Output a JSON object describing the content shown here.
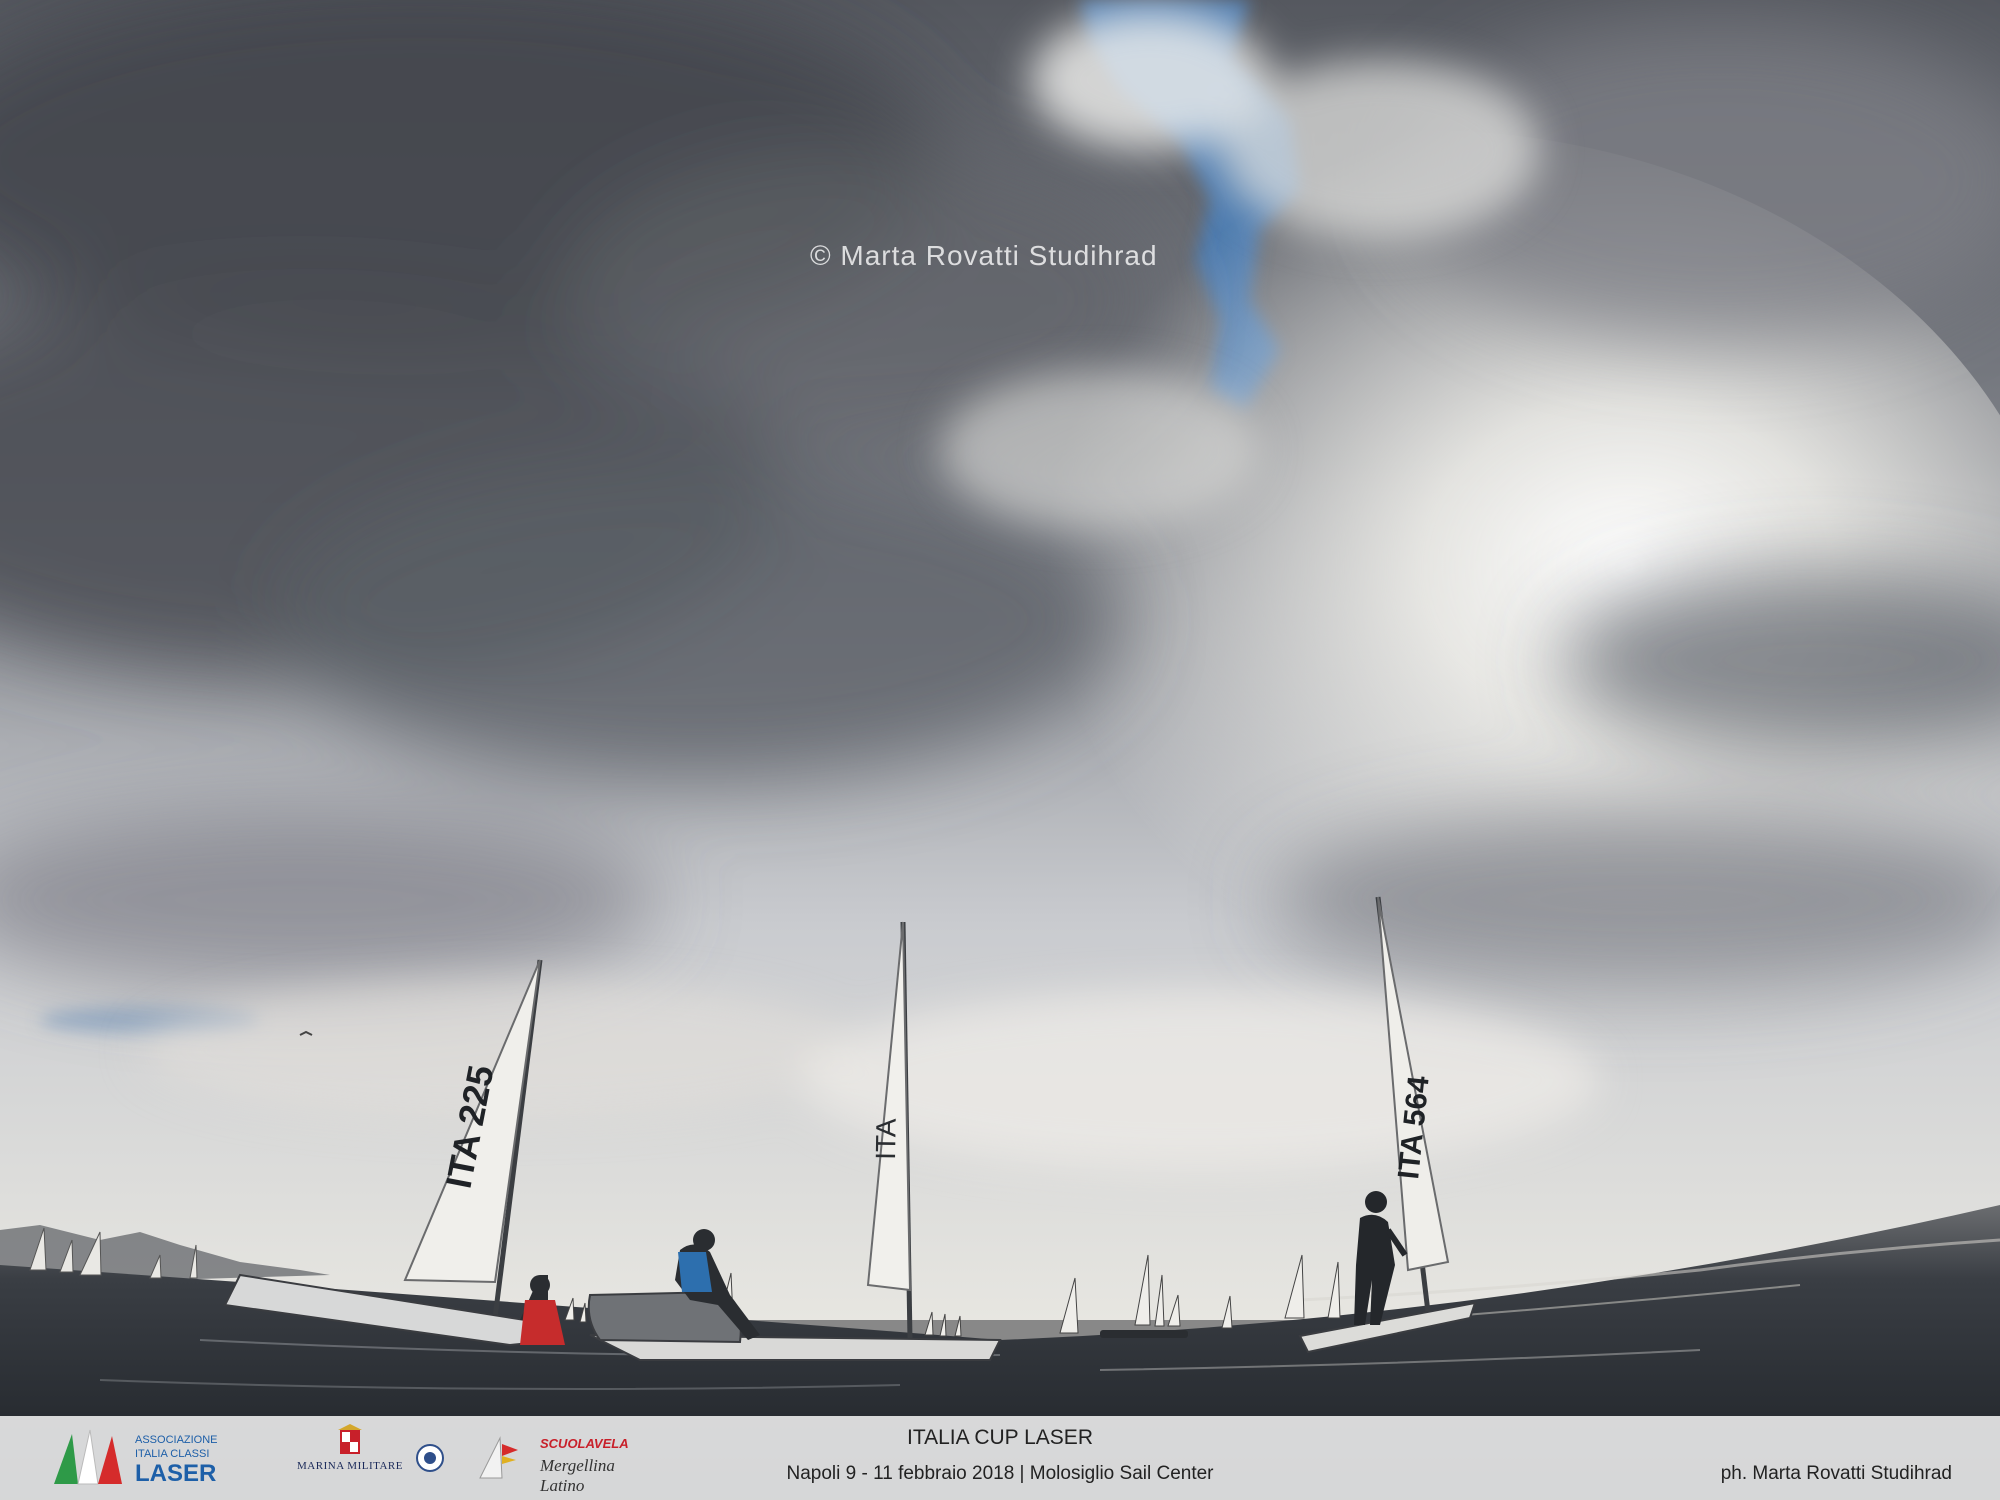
{
  "watermark": "© Marta Rovatti Studihrad",
  "sail_numbers": {
    "left_boat": "ITA 225",
    "right_boat": "ITA 564"
  },
  "footer": {
    "title": "ITALIA CUP LASER",
    "subtitle": "Napoli 9 - 11 febbraio 2018 | Molosiglio Sail Center",
    "credit": "ph. Marta Rovatti Studihrad",
    "logos": {
      "association_line1": "ASSOCIAZIONE",
      "association_line2": "ITALIA CLASSI",
      "association_line3": "LASER",
      "navy": "MARINA MILITARE",
      "school_top": "SCUOLAVELA",
      "school_bottom": "Mergellina Latino"
    }
  },
  "colors": {
    "sky_blue": "#4f7db0",
    "sea_dark": "#262b31",
    "cloud_dark": "#5c6068",
    "footer_bg": "#ffffff",
    "laser_blue": "#1d5fa8",
    "flag_green": "#2e9a48",
    "flag_red": "#d52b2b"
  }
}
